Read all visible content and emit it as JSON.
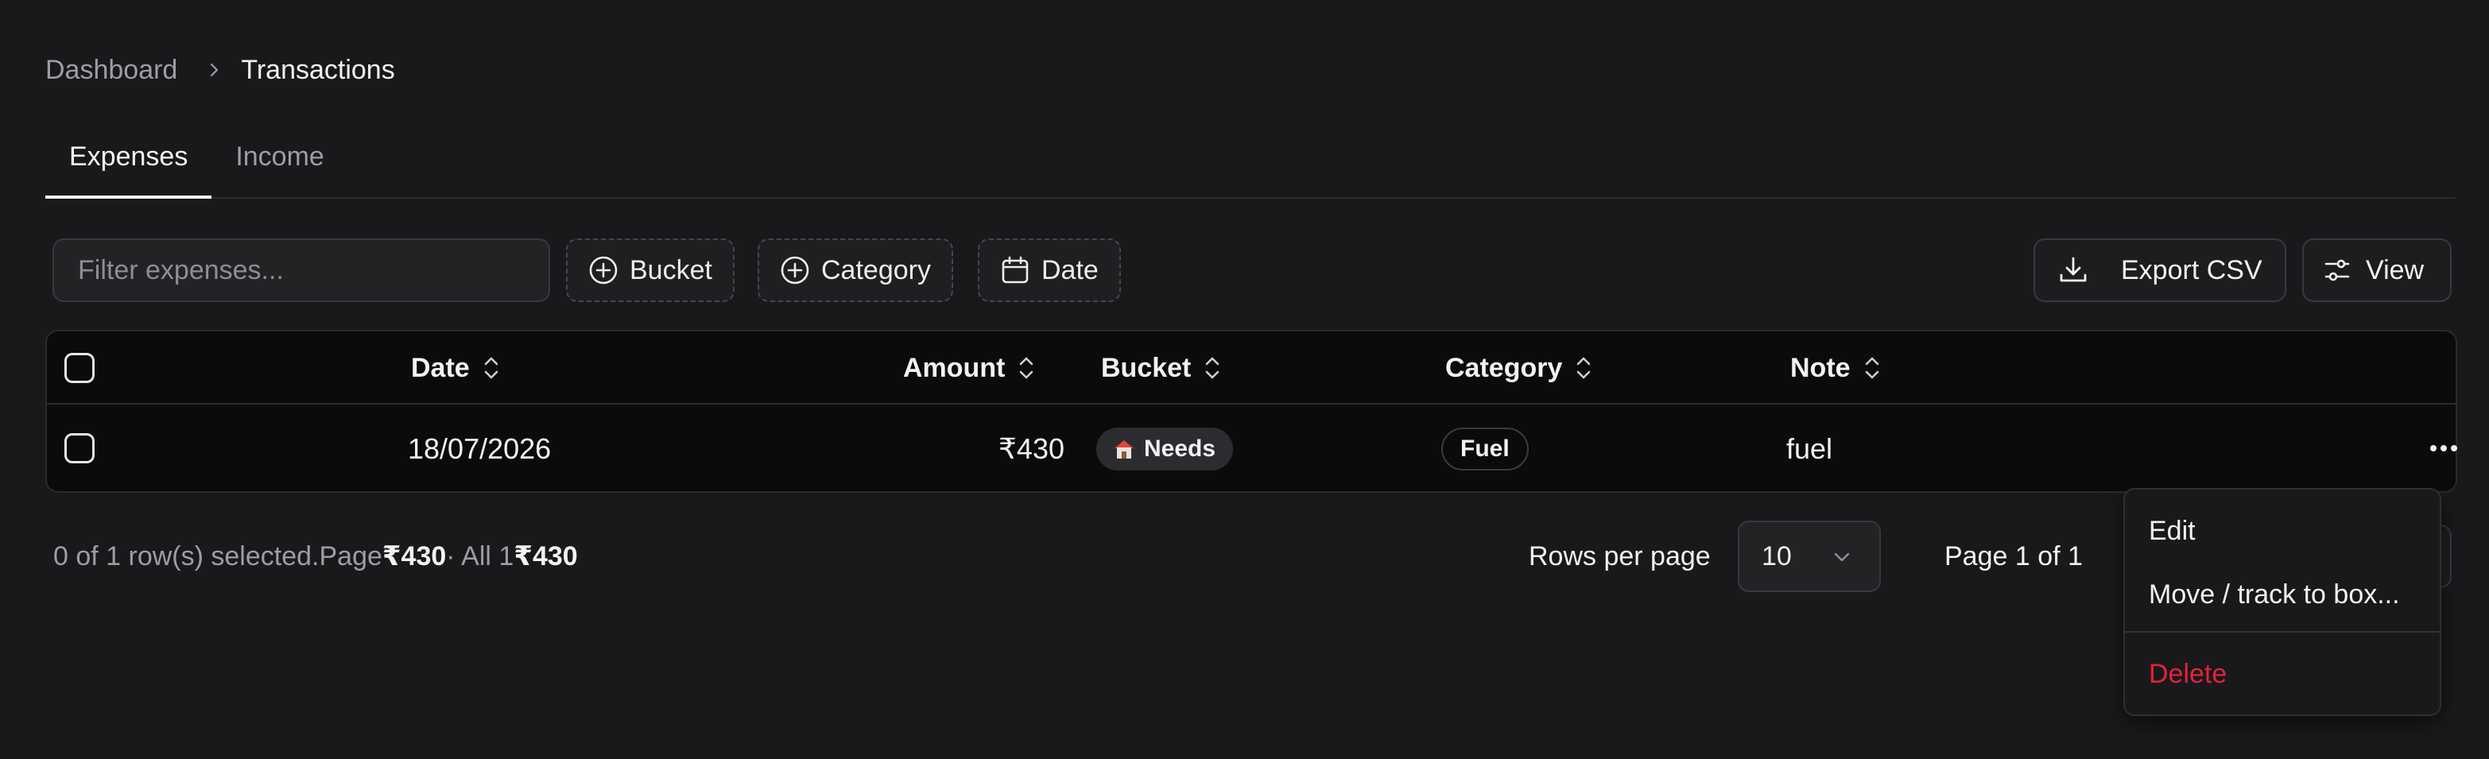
{
  "breadcrumb": {
    "parent": "Dashboard",
    "current": "Transactions"
  },
  "tabs": [
    {
      "label": "Expenses",
      "active": true
    },
    {
      "label": "Income",
      "active": false
    }
  ],
  "toolbar": {
    "filter_placeholder": "Filter expenses...",
    "filter_value": "",
    "bucket_label": "Bucket",
    "category_label": "Category",
    "date_label": "Date",
    "export_label": "Export CSV",
    "view_label": "View"
  },
  "table": {
    "columns": [
      "Date",
      "Amount",
      "Bucket",
      "Category",
      "Note"
    ],
    "rows": [
      {
        "date": "18/07/2026",
        "amount": "₹430",
        "bucket": "Needs",
        "bucket_icon": "house-icon",
        "category": "Fuel",
        "note": "fuel"
      }
    ]
  },
  "footer": {
    "selected_text": "0 of 1 row(s) selected.",
    "page_label": "Page",
    "page_total": "₹430",
    "all_label": "· All 1",
    "all_total": "₹430",
    "rows_per_page_label": "Rows per page",
    "rows_per_page_value": "10",
    "page_indicator": "Page 1 of 1"
  },
  "row_menu": {
    "edit": "Edit",
    "move": "Move / track to box...",
    "delete": "Delete"
  },
  "colors": {
    "background": "#19191b",
    "table_background": "#0b0b0c",
    "danger": "#e0243a",
    "text": "#f2f2f2",
    "muted": "#9d9da2"
  }
}
